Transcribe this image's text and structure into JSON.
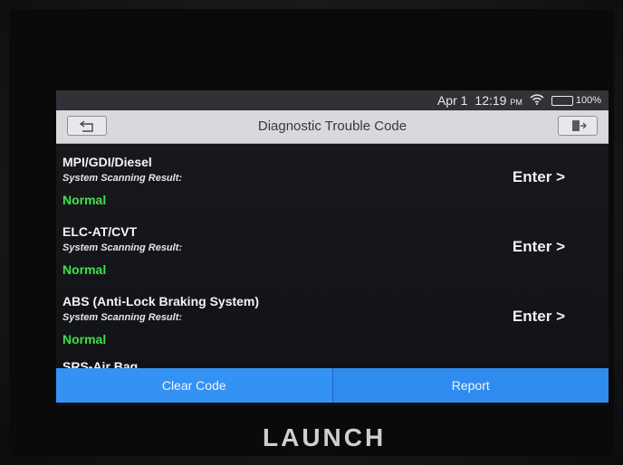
{
  "status_bar": {
    "date": "Apr 1",
    "time": "12:19",
    "meridiem": "PM",
    "wifi_icon": "wifi-icon",
    "battery_icon": "battery-icon",
    "battery_percent": "100%",
    "battery_level": 1.0
  },
  "header": {
    "title": "Diagnostic Trouble Code",
    "back_icon": "back-icon",
    "exit_icon": "exit-icon"
  },
  "systems": [
    {
      "name": "MPI/GDI/Diesel",
      "subtitle": "System Scanning Result:",
      "status": "Normal",
      "action": "Enter >"
    },
    {
      "name": "ELC-AT/CVT",
      "subtitle": "System Scanning Result:",
      "status": "Normal",
      "action": "Enter >"
    },
    {
      "name": "ABS (Anti-Lock Braking System)",
      "subtitle": "System Scanning Result:",
      "status": "Normal",
      "action": "Enter >"
    },
    {
      "name": "SRS-Air Bag",
      "subtitle": "",
      "status": "",
      "action": ""
    }
  ],
  "footer": {
    "clear_code_label": "Clear Code",
    "report_label": "Report"
  },
  "device": {
    "brand": "LAUNCH"
  },
  "colors": {
    "accent_blue": "#2f8df2",
    "status_green": "#3ee04a",
    "battery_green": "#37d33a"
  }
}
